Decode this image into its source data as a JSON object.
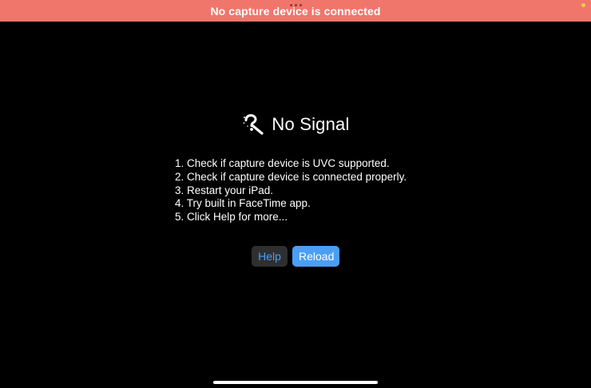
{
  "banner": {
    "message": "No capture device is connected",
    "color": "#f0766b"
  },
  "status": {
    "indicator_color": "#f2c94c"
  },
  "main": {
    "icon": "magnifier-question-icon",
    "title": "No Signal",
    "steps": [
      "1. Check if capture device is UVC supported.",
      "2. Check if capture device is connected properly.",
      "3. Restart your iPad.",
      "4. Try built in FaceTime app.",
      "5. Click Help for more..."
    ]
  },
  "actions": {
    "help_label": "Help",
    "reload_label": "Reload",
    "accent_color": "#4a9ff5"
  }
}
